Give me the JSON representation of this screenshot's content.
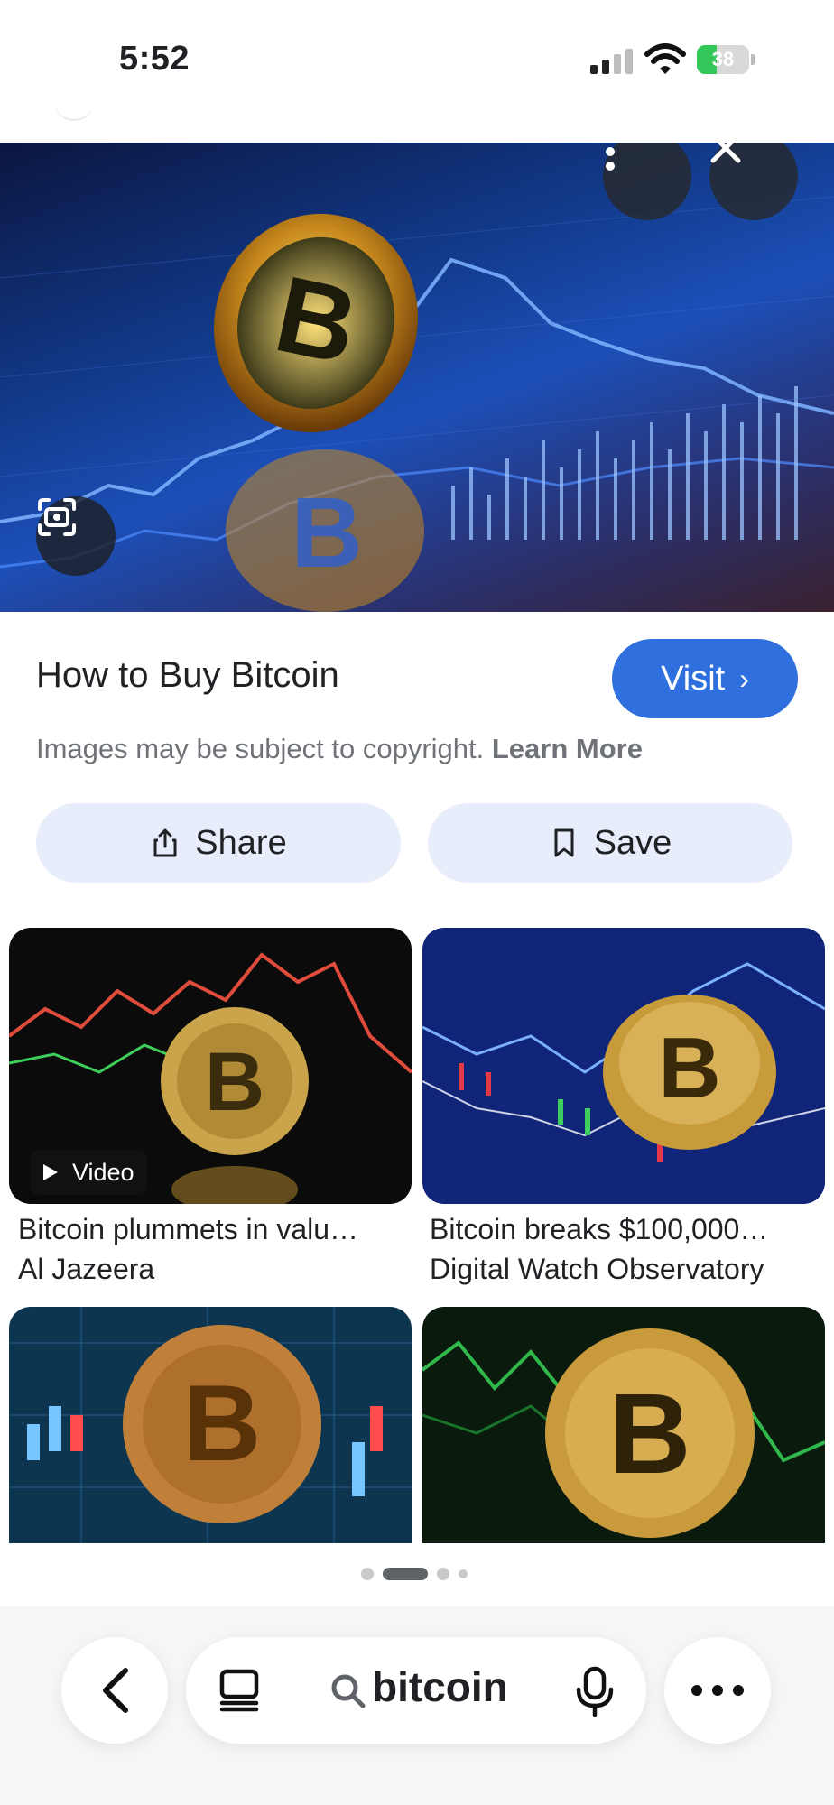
{
  "status_bar": {
    "time": "5:52",
    "battery_percent": "38",
    "battery_level": 0.38,
    "battery_color": "#34c759"
  },
  "image_viewer": {
    "more_icon": "more-vertical-icon",
    "close_icon": "close-icon",
    "lens_icon": "google-lens-icon",
    "title": "How to Buy Bitcoin",
    "visit_label": "Visit",
    "copyright_text": "Images may be subject to copyright.",
    "learn_more_label": "Learn More",
    "share_label": "Share",
    "save_label": "Save",
    "accent_color": "#2f6fde"
  },
  "related": [
    {
      "title": "Bitcoin plummets in valu…",
      "source": "Al Jazeera",
      "badge": "Video"
    },
    {
      "title": "Bitcoin breaks $100,000…",
      "source": "Digital Watch Observatory",
      "badge": ""
    },
    {
      "title": "",
      "source": "",
      "badge": ""
    },
    {
      "title": "",
      "source": "",
      "badge": ""
    }
  ],
  "pagination": {
    "total": 4,
    "active": 2
  },
  "toolbar": {
    "back_icon": "back-chevron-icon",
    "tabs_icon": "tabs-icon",
    "search_icon": "search-icon",
    "query": "bitcoin",
    "mic_icon": "microphone-icon",
    "more_icon": "more-horizontal-icon"
  }
}
